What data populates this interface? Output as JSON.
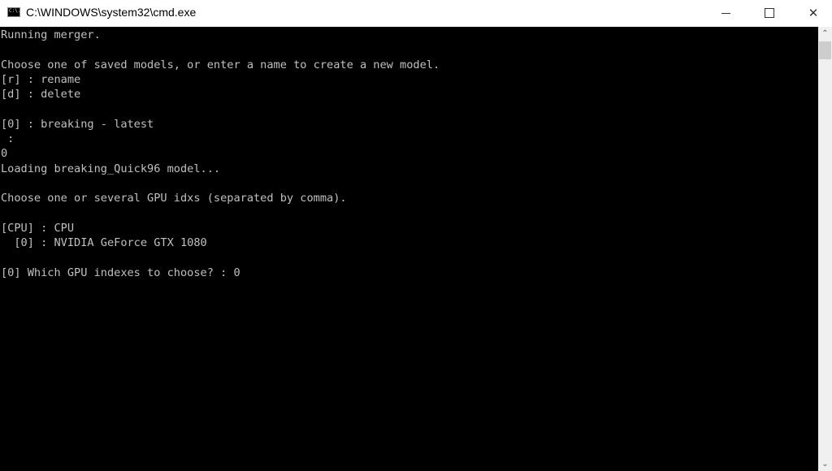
{
  "window": {
    "title": "C:\\WINDOWS\\system32\\cmd.exe",
    "icon_label": "C:\\."
  },
  "console": {
    "lines": [
      "Running merger.",
      "",
      "Choose one of saved models, or enter a name to create a new model.",
      "[r] : rename",
      "[d] : delete",
      "",
      "[0] : breaking - latest",
      " :",
      "0",
      "Loading breaking_Quick96 model...",
      "",
      "Choose one or several GPU idxs (separated by comma).",
      "",
      "[CPU] : CPU",
      "  [0] : NVIDIA GeForce GTX 1080",
      "",
      "[0] Which GPU indexes to choose? : 0"
    ]
  },
  "icons": {
    "minimize": "minimize-icon",
    "maximize": "maximize-icon",
    "close": "close-icon",
    "scroll_up": "chevron-up-icon",
    "scroll_down": "chevron-down-icon"
  },
  "glyphs": {
    "close": "✕",
    "up": "⌃",
    "down": "⌄"
  }
}
